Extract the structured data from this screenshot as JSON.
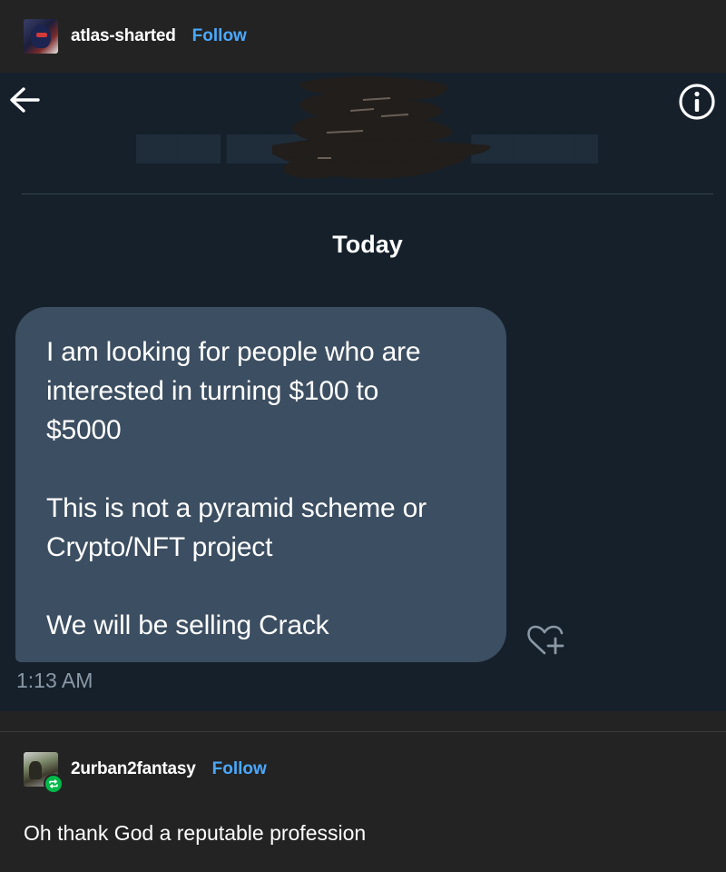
{
  "post": {
    "author": "atlas-sharted",
    "follow_label": "Follow"
  },
  "dm": {
    "date_divider": "Today",
    "message_lines": [
      "I am looking for people who are",
      "interested in turning $100 to",
      "$5000",
      "",
      "This is not a pyramid scheme or",
      "Crypto/NFT project",
      "",
      "We will be selling Crack"
    ],
    "timestamp": "1:13 AM",
    "icons": {
      "back": "back-arrow-icon",
      "info": "info-icon",
      "react": "heart-plus-icon"
    }
  },
  "reblog": {
    "author": "2urban2fantasy",
    "follow_label": "Follow",
    "badge_icon": "reblog-icon",
    "comment": "Oh thank God a reputable profession"
  },
  "colors": {
    "page_bg": "#232323",
    "dm_bg": "#15202b",
    "bubble_bg": "#3c4e61",
    "follow_link": "#4aa8ff",
    "reblog_badge": "#00b84a"
  }
}
